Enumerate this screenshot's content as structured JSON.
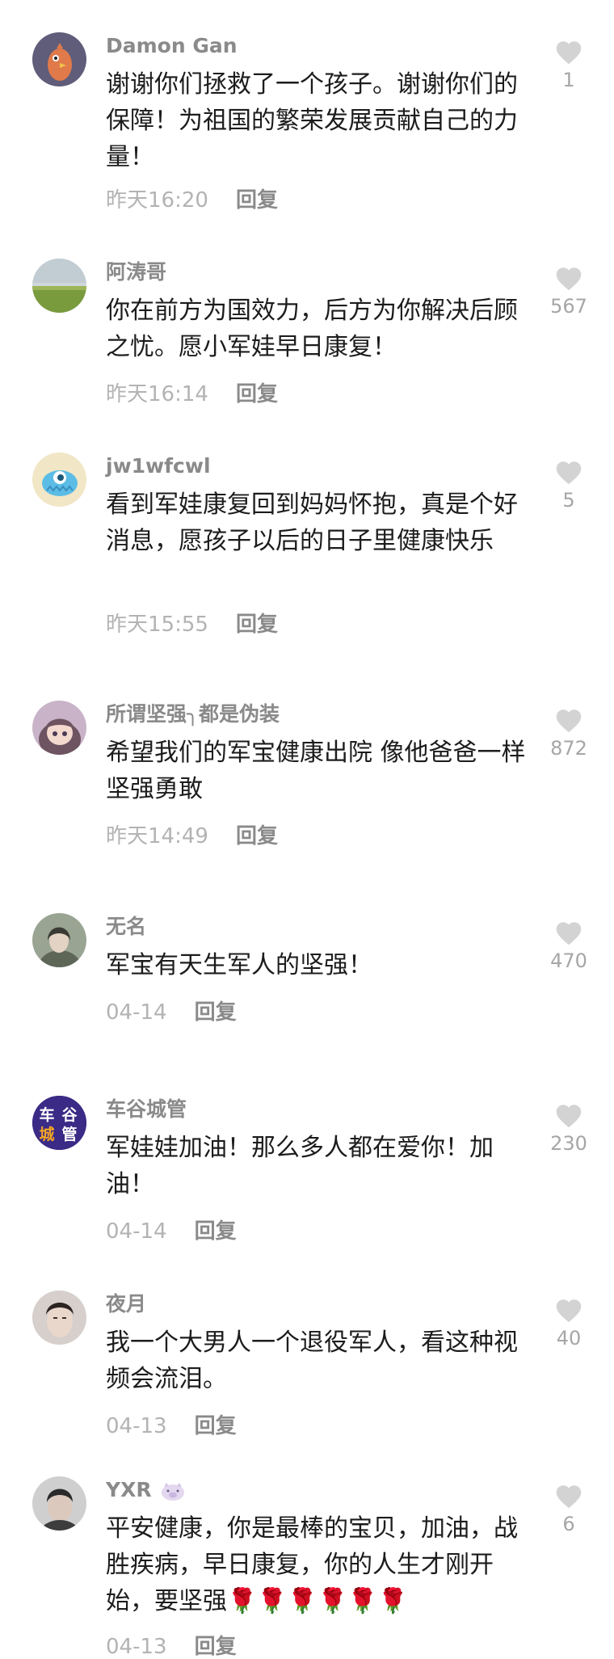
{
  "comments": [
    {
      "username": "Damon Gan",
      "text": "谢谢你们拯救了一个孩子。谢谢你们的保障！为祖国的繁荣发展贡献自己的力量！",
      "time": "昨天16:20",
      "reply": "回复",
      "likes": "1",
      "avatar": "orange-bird-avatar"
    },
    {
      "username": "阿涛哥",
      "text": "你在前方为国效力，后方为你解决后顾之忧。愿小军娃早日康复！",
      "time": "昨天16:14",
      "reply": "回复",
      "likes": "567",
      "avatar": "green-field-avatar"
    },
    {
      "username": "jw1wfcwl",
      "text": "看到军娃康复回到妈妈怀抱，真是个好消息，愿孩子以后的日子里健康快乐",
      "time": "昨天15:55",
      "reply": "回复",
      "likes": "5",
      "avatar": "blue-monster-avatar"
    },
    {
      "username": "所谓坚强╮都是伪装",
      "text": "希望我们的军宝健康出院 像他爸爸一样坚强勇敢",
      "time": "昨天14:49",
      "reply": "回复",
      "likes": "872",
      "avatar": "anime-girl-avatar"
    },
    {
      "username": "无名",
      "text": "军宝有天生军人的坚强！",
      "time": "04-14",
      "reply": "回复",
      "likes": "470",
      "avatar": "portrait-avatar"
    },
    {
      "username": "车谷城管",
      "text": "军娃娃加油！那么多人都在爱你！加油！",
      "time": "04-14",
      "reply": "回复",
      "likes": "230",
      "avatar": "text-logo-avatar",
      "avatar_text": "车谷城管"
    },
    {
      "username": "夜月",
      "text": "我一个大男人一个退役军人，看这种视频会流泪。",
      "time": "04-13",
      "reply": "回复",
      "likes": "40",
      "avatar": "man-face-avatar"
    },
    {
      "username": "YXR",
      "text": "平安健康，你是最棒的宝贝，加油，战胜疾病，早日康复，你的人生才刚开始，要坚强🌹🌹🌹🌹🌹🌹",
      "time": "04-13",
      "reply": "回复",
      "likes": "6",
      "avatar": "man-face-avatar",
      "badge": "pig-emoji-icon"
    }
  ],
  "colors": {
    "username": "#8a8a8a",
    "text": "#1c1c1c",
    "time": "#b3b3b3",
    "like_icon": "#d3d3d3"
  }
}
